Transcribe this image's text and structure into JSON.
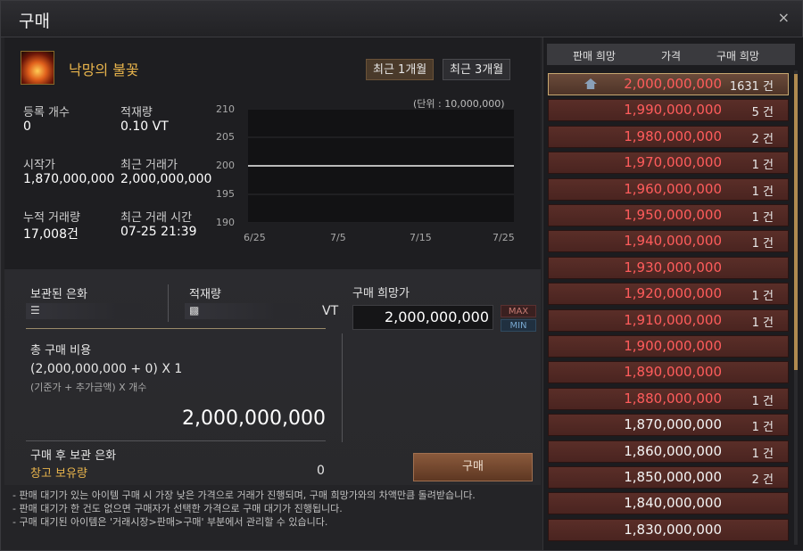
{
  "window": {
    "title": "구매",
    "close_symbol": "×"
  },
  "item": {
    "name": "낙망의 불꽃",
    "icon": "flame-icon"
  },
  "period_buttons": [
    {
      "label": "최근 1개월",
      "active": true
    },
    {
      "label": "최근 3개월",
      "active": false
    }
  ],
  "stats": {
    "registered_label": "등록 개수",
    "registered_value": "0",
    "stock_label": "적재량",
    "stock_value": "0.10 VT",
    "start_price_label": "시작가",
    "start_price_value": "1,870,000,000",
    "recent_price_label": "최근 거래가",
    "recent_price_value": "2,000,000,000",
    "cumulative_label": "누적 거래량",
    "cumulative_value": "17,008건",
    "recent_time_label": "최근 거래 시간",
    "recent_time_value": "07-25 21:39"
  },
  "chart_data": {
    "type": "line",
    "unit_label": "(단위 : 10,000,000)",
    "y_ticks": [
      "210",
      "205",
      "200",
      "195",
      "190"
    ],
    "x_ticks": [
      "6/25",
      "7/5",
      "7/15",
      "7/25"
    ],
    "ylim": [
      190,
      210
    ],
    "series": [
      {
        "values": [
          200,
          200
        ]
      }
    ],
    "grid": true
  },
  "wallet": {
    "stored_silver_label": "보관된 은화",
    "weight_label": "적재량",
    "weight_unit": "VT",
    "coin_icon": "coin-stack-icon",
    "weight_icon": "weight-icon"
  },
  "purchase": {
    "desired_price_label": "구매 희망가",
    "desired_price_value": "2,000,000,000",
    "max_label": "MAX",
    "min_label": "MIN",
    "total_cost_label": "총 구매 비용",
    "formula": "(2,000,000,000 + 0) X 1",
    "formula_hint": "(기준가 + 추가금액) X 개수",
    "total_value": "2,000,000,000",
    "after_label": "구매 후 보관 은화",
    "warehouse_label": "창고 보유량",
    "warehouse_value": "0",
    "buy_button": "구매"
  },
  "notes": [
    "- 판매 대기가 있는 아이템 구매 시 가장 낮은 가격으로 거래가 진행되며, 구매 희망가와의 차액만큼 돌려받습니다.",
    "- 판매 대기가 한 건도 없으면 구매자가 선택한 가격으로 구매 대기가 진행됩니다.",
    "- 구매 대기된 아이템은 '거래시장>판매>구매' 부분에서 관리할 수 있습니다."
  ],
  "order_book": {
    "headers": [
      "판매 희망",
      "가격",
      "구매 희망"
    ],
    "rows": [
      {
        "price": "2,000,000,000",
        "count": "1631 건",
        "selected": true,
        "color": "red"
      },
      {
        "price": "1,990,000,000",
        "count": "5 건",
        "color": "red"
      },
      {
        "price": "1,980,000,000",
        "count": "2 건",
        "color": "red"
      },
      {
        "price": "1,970,000,000",
        "count": "1 건",
        "color": "red"
      },
      {
        "price": "1,960,000,000",
        "count": "1 건",
        "color": "red"
      },
      {
        "price": "1,950,000,000",
        "count": "1 건",
        "color": "red"
      },
      {
        "price": "1,940,000,000",
        "count": "1 건",
        "color": "red"
      },
      {
        "price": "1,930,000,000",
        "count": "",
        "color": "red"
      },
      {
        "price": "1,920,000,000",
        "count": "1 건",
        "color": "red"
      },
      {
        "price": "1,910,000,000",
        "count": "1 건",
        "color": "red"
      },
      {
        "price": "1,900,000,000",
        "count": "",
        "color": "red"
      },
      {
        "price": "1,890,000,000",
        "count": "",
        "color": "red"
      },
      {
        "price": "1,880,000,000",
        "count": "1 건",
        "color": "red"
      },
      {
        "price": "1,870,000,000",
        "count": "1 건",
        "color": "white"
      },
      {
        "price": "1,860,000,000",
        "count": "1 건",
        "color": "white"
      },
      {
        "price": "1,850,000,000",
        "count": "2 건",
        "color": "white"
      },
      {
        "price": "1,840,000,000",
        "count": "",
        "color": "white"
      },
      {
        "price": "1,830,000,000",
        "count": "",
        "color": "white"
      }
    ]
  }
}
